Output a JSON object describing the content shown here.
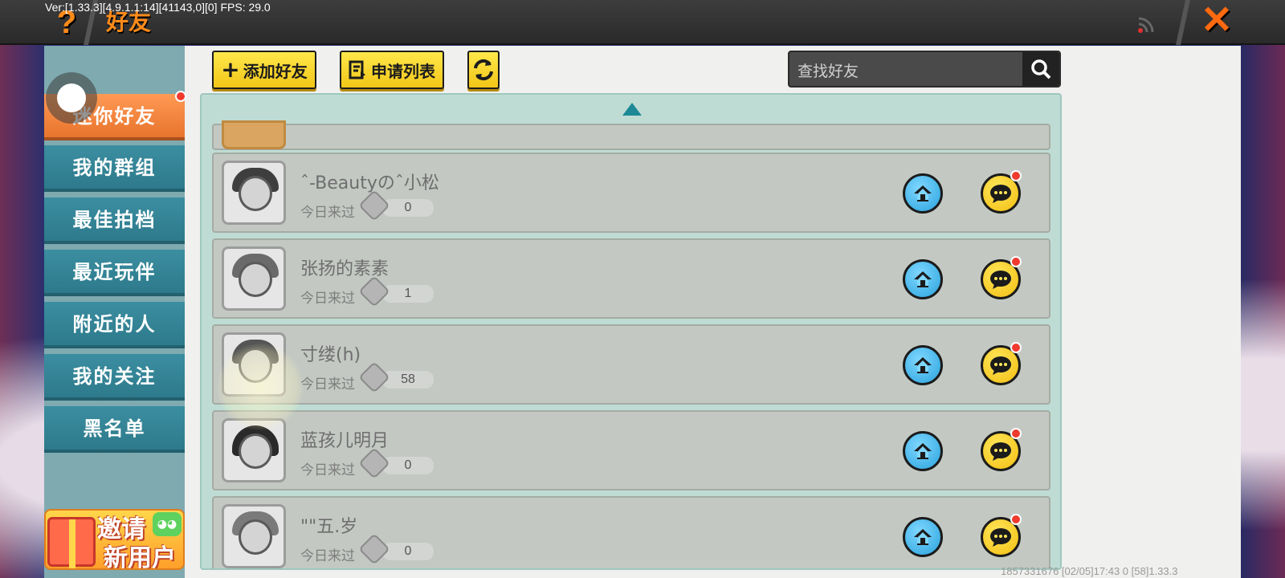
{
  "debug": {
    "version": "Ver:[1.33.3][4.9.1.1:14][41143,0][0] FPS: 29.0"
  },
  "header": {
    "help": "?",
    "title": "好友",
    "close": "✕"
  },
  "toolbar": {
    "add_friend": "添加好友",
    "request_list": "申请列表",
    "search_placeholder": "查找好友"
  },
  "sidebar": {
    "items": [
      {
        "label": "迷你好友"
      },
      {
        "label": "我的群组"
      },
      {
        "label": "最佳拍档"
      },
      {
        "label": "最近玩伴"
      },
      {
        "label": "附近的人"
      },
      {
        "label": "我的关注"
      },
      {
        "label": "黑名单"
      }
    ],
    "invite_line1": "邀请",
    "invite_line2": "新用户"
  },
  "friends": [
    {
      "name": "ˆ-Beautyのˆ小松",
      "visited": "今日来过",
      "count": "0"
    },
    {
      "name": "张扬的素素",
      "visited": "今日来过",
      "count": "1"
    },
    {
      "name": "寸缕(h)",
      "visited": "今日来过",
      "count": "58"
    },
    {
      "name": "蓝孩儿明月",
      "visited": "今日来过",
      "count": "0"
    },
    {
      "name": "\"\"五.岁",
      "visited": "今日来过",
      "count": "0"
    }
  ],
  "footer": {
    "info": "1857331676    [02/05]17:43 0   [58]1.33.3"
  },
  "colors": {
    "accent": "#ff8b1a",
    "tab": "#2d7a8c",
    "active_tab": "#e8742c",
    "button": "#f2c618"
  }
}
